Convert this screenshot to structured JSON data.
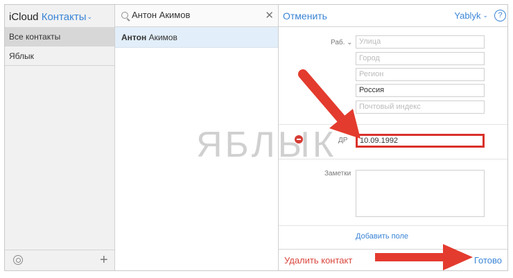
{
  "sidebar": {
    "app_name": "iCloud",
    "section": "Контакты",
    "groups": [
      {
        "label": "Все контакты",
        "active": true
      },
      {
        "label": "Яблык",
        "active": false
      }
    ]
  },
  "list": {
    "search_value": "Антон Акимов",
    "contacts": [
      {
        "first": "Антон",
        "last": "Акимов"
      }
    ]
  },
  "detail": {
    "cancel_label": "Отменить",
    "account_label": "Yablyk",
    "help_label": "?",
    "address_label": "Раб.",
    "address_fields": {
      "street": "Улица",
      "city": "Город",
      "region": "Регион",
      "country": "Россия",
      "zip": "Почтовый индекс"
    },
    "birthday_label": "ДР",
    "birthday_value": "10.09.1992",
    "notes_label": "Заметки",
    "add_field_label": "Добавить поле",
    "delete_label": "Удалить контакт",
    "done_label": "Готово"
  },
  "watermark": "ЯБЛЫК",
  "colors": {
    "accent": "#3a84d6",
    "highlight": "#d9312b",
    "selected_row": "#e2eef9"
  }
}
